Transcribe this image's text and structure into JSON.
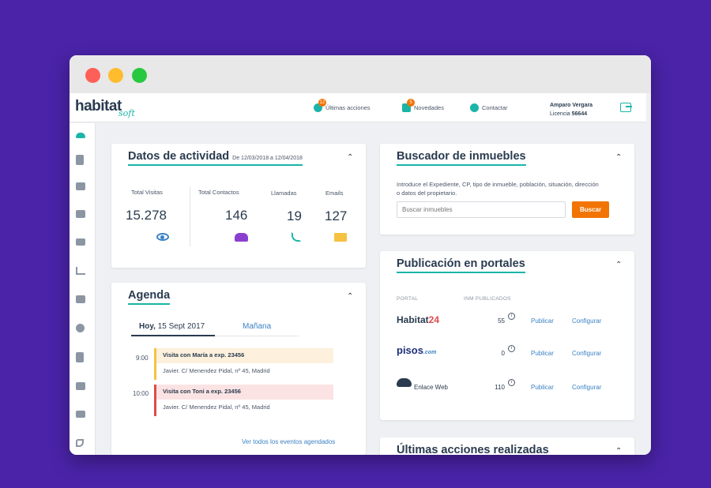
{
  "brand": {
    "logo": "habitat",
    "logo_sub": "soft"
  },
  "topnav": {
    "items": [
      {
        "label": "Últimas acciones",
        "badge": "12",
        "icon": "clock-icon"
      },
      {
        "label": "Novedades",
        "badge": "5",
        "icon": "news-icon"
      },
      {
        "label": "Contactar",
        "icon": "chat-icon"
      }
    ],
    "user_name": "Amparo Vergara",
    "license_label": "Licencia",
    "license_number": "56644"
  },
  "sidebar": {
    "icons": [
      "dashboard-icon",
      "building-icon",
      "home-icon",
      "megaphone-icon",
      "users-icon",
      "chart-icon",
      "house-icon",
      "coins-icon",
      "document-icon",
      "calendar-icon",
      "mail-icon",
      "phone-icon"
    ]
  },
  "activity": {
    "title": "Datos de actividad",
    "date_range": "De 12/03/2018 a 12/04/2018",
    "stats": [
      {
        "label": "Total Visitas",
        "value": "15.278",
        "icon": "eye-icon",
        "color": "#3b82c4"
      },
      {
        "label": "Total Contactos",
        "value": "146",
        "icon": "users-icon",
        "color": "#8b3fd0"
      },
      {
        "label": "Llamadas",
        "value": "19",
        "icon": "phone-icon",
        "color": "#1bb5a8"
      },
      {
        "label": "Emails",
        "value": "127",
        "icon": "mail-icon",
        "color": "#f5c242"
      }
    ]
  },
  "agenda": {
    "title": "Agenda",
    "tab_today_bold": "Hoy,",
    "tab_today_date": " 15 Sept 2017",
    "tab_tomorrow": "Mañana",
    "events": [
      {
        "time": "9:00",
        "title": "Visita con María a exp. 23456",
        "detail": "Javier. C/ Menendez Pidal, nº 45, Madrid",
        "color": "#f5c242",
        "bg": "#fdf0dc"
      },
      {
        "time": "10:00",
        "title": "Visita con Toni a exp. 23456",
        "detail": "Javier. C/ Menendez Pidal, nº 45, Madrid",
        "color": "#e04a4a",
        "bg": "#fbe3e3"
      }
    ],
    "see_all": "Ver todos los eventos agendados"
  },
  "search": {
    "title": "Buscador de inmuebles",
    "description": "Introduce el Expediente, CP, tipo de inmueble, población, situación, dirección o datos del propietario.",
    "placeholder": "Buscar inmuebles",
    "button": "Buscar"
  },
  "portals": {
    "title": "Publicación en portales",
    "col_portal": "PORTAL",
    "col_count": "INM PUBLICADOS",
    "rows": [
      {
        "name_main": "Habitat",
        "name_accent": "24",
        "count": "55",
        "publish": "Publicar",
        "configure": "Configurar"
      },
      {
        "name_main": "pisos",
        "name_accent": ".com",
        "count": "0",
        "publish": "Publicar",
        "configure": "Configurar"
      },
      {
        "name_main": "Enlace Web",
        "name_accent": "",
        "count": "110",
        "publish": "Publicar",
        "configure": "Configurar"
      }
    ]
  },
  "last_actions": {
    "title": "Últimas acciones realizadas"
  },
  "colors": {
    "accent": "#1bb5a8",
    "primary_button": "#f27405",
    "link": "#3b82c4",
    "background": "#4a23a8"
  }
}
